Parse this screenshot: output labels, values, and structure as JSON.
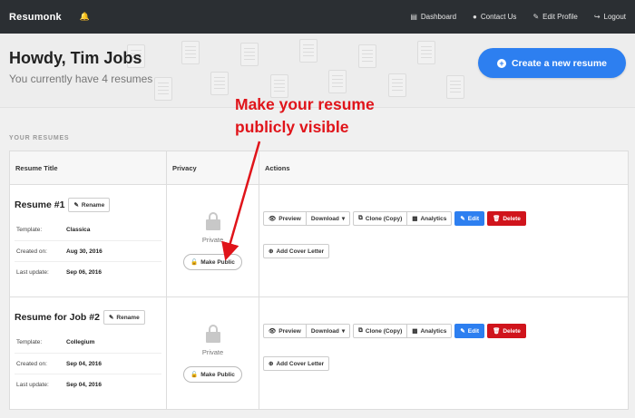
{
  "nav": {
    "brand": "Resumonk",
    "links": [
      {
        "label": "Dashboard",
        "icon": "dashboard-icon"
      },
      {
        "label": "Contact Us",
        "icon": "chat-icon"
      },
      {
        "label": "Edit Profile",
        "icon": "pencil-icon"
      },
      {
        "label": "Logout",
        "icon": "logout-icon"
      }
    ]
  },
  "hero": {
    "greeting": "Howdy, Tim Jobs",
    "subtitle": "You currently have 4 resumes",
    "create_button": "Create a new resume"
  },
  "section_title": "YOUR RESUMES",
  "table": {
    "headers": [
      "Resume Title",
      "Privacy",
      "Actions"
    ],
    "rows": [
      {
        "title": "Resume #1",
        "rename": "Rename",
        "template_label": "Template:",
        "template": "Classica",
        "created_label": "Created on:",
        "created": "Aug 30, 2016",
        "updated_label": "Last update:",
        "updated": "Sep 06, 2016",
        "privacy": "Private",
        "make_public": "Make Public",
        "actions": {
          "preview": "Preview",
          "download": "Download",
          "clone": "Clone (Copy)",
          "analytics": "Analytics",
          "edit": "Edit",
          "delete": "Delete",
          "cover_letter": "Add Cover Letter"
        }
      },
      {
        "title": "Resume for Job #2",
        "rename": "Rename",
        "template_label": "Template:",
        "template": "Collegium",
        "created_label": "Created on:",
        "created": "Sep 04, 2016",
        "updated_label": "Last update:",
        "updated": "Sep 04, 2016",
        "privacy": "Private",
        "make_public": "Make Public",
        "actions": {
          "preview": "Preview",
          "download": "Download",
          "clone": "Clone (Copy)",
          "analytics": "Analytics",
          "edit": "Edit",
          "delete": "Delete",
          "cover_letter": "Add Cover Letter"
        }
      }
    ]
  },
  "annotation": {
    "line1": "Make your resume",
    "line2": "publicly visible",
    "color": "#e0141a"
  },
  "colors": {
    "accent": "#2d7ff0",
    "danger": "#d0141c",
    "nav_bg": "#2b2f33"
  }
}
